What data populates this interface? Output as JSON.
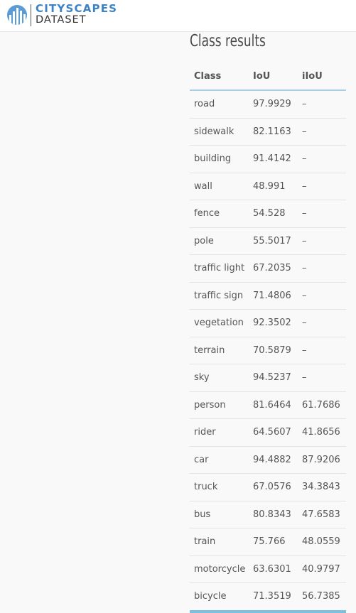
{
  "brand": {
    "name_top": "CITYSCAPES",
    "name_bottom": "DATASET",
    "logo_color": "#3d82c4"
  },
  "section": {
    "title": "Class results"
  },
  "table": {
    "headers": [
      "Class",
      "IoU",
      "iIoU"
    ],
    "rows": [
      {
        "class": "road",
        "iou": "97.9929",
        "iiou": "–"
      },
      {
        "class": "sidewalk",
        "iou": "82.1163",
        "iiou": "–"
      },
      {
        "class": "building",
        "iou": "91.4142",
        "iiou": "–"
      },
      {
        "class": "wall",
        "iou": "48.991",
        "iiou": "–"
      },
      {
        "class": "fence",
        "iou": "54.528",
        "iiou": "–"
      },
      {
        "class": "pole",
        "iou": "55.5017",
        "iiou": "–"
      },
      {
        "class": "traffic light",
        "iou": "67.2035",
        "iiou": "–"
      },
      {
        "class": "traffic sign",
        "iou": "71.4806",
        "iiou": "–"
      },
      {
        "class": "vegetation",
        "iou": "92.3502",
        "iiou": "–"
      },
      {
        "class": "terrain",
        "iou": "70.5879",
        "iiou": "–"
      },
      {
        "class": "sky",
        "iou": "94.5237",
        "iiou": "–"
      },
      {
        "class": "person",
        "iou": "81.6464",
        "iiou": "61.7686"
      },
      {
        "class": "rider",
        "iou": "64.5607",
        "iiou": "41.8656"
      },
      {
        "class": "car",
        "iou": "94.4882",
        "iiou": "87.9206"
      },
      {
        "class": "truck",
        "iou": "67.0576",
        "iiou": "34.3843"
      },
      {
        "class": "bus",
        "iou": "80.8343",
        "iiou": "47.6583"
      },
      {
        "class": "train",
        "iou": "75.766",
        "iiou": "48.0559"
      },
      {
        "class": "motorcycle",
        "iou": "63.6301",
        "iiou": "40.9797"
      },
      {
        "class": "bicycle",
        "iou": "71.3519",
        "iiou": "56.7385"
      }
    ]
  }
}
